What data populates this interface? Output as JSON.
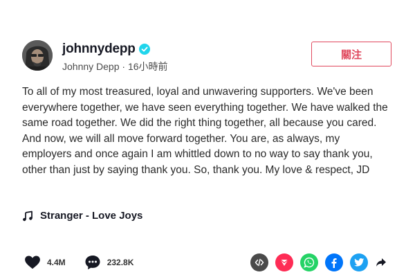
{
  "post": {
    "username": "johnnydepp",
    "display_name": "Johnny Depp",
    "separator": " · ",
    "time_ago": "16小時前",
    "follow_label": "關注",
    "caption": "To all of my most treasured, loyal and unwavering supporters. We've been everywhere together, we have seen everything together. We have walked the same road together. We did the right thing together, all because you cared. And now, we will all move forward together. You are, as always, my employers and once again I am whittled down to no way to say thank you, other than just by saying thank you. So, thank you. My love & respect, JD",
    "music": "Stranger - Love Joys"
  },
  "stats": {
    "likes": "4.4M",
    "comments": "232.8K"
  },
  "share_icons": [
    "embed-icon",
    "send-icon",
    "whatsapp-icon",
    "facebook-icon",
    "twitter-icon",
    "share-arrow-icon"
  ],
  "colors": {
    "accent": "#e0485d",
    "verified": "#20d5ec",
    "embed": "#4a4a4a",
    "send": "#fe2c55",
    "whatsapp": "#25d366",
    "facebook": "#0075fa",
    "twitter": "#1da1f2"
  }
}
